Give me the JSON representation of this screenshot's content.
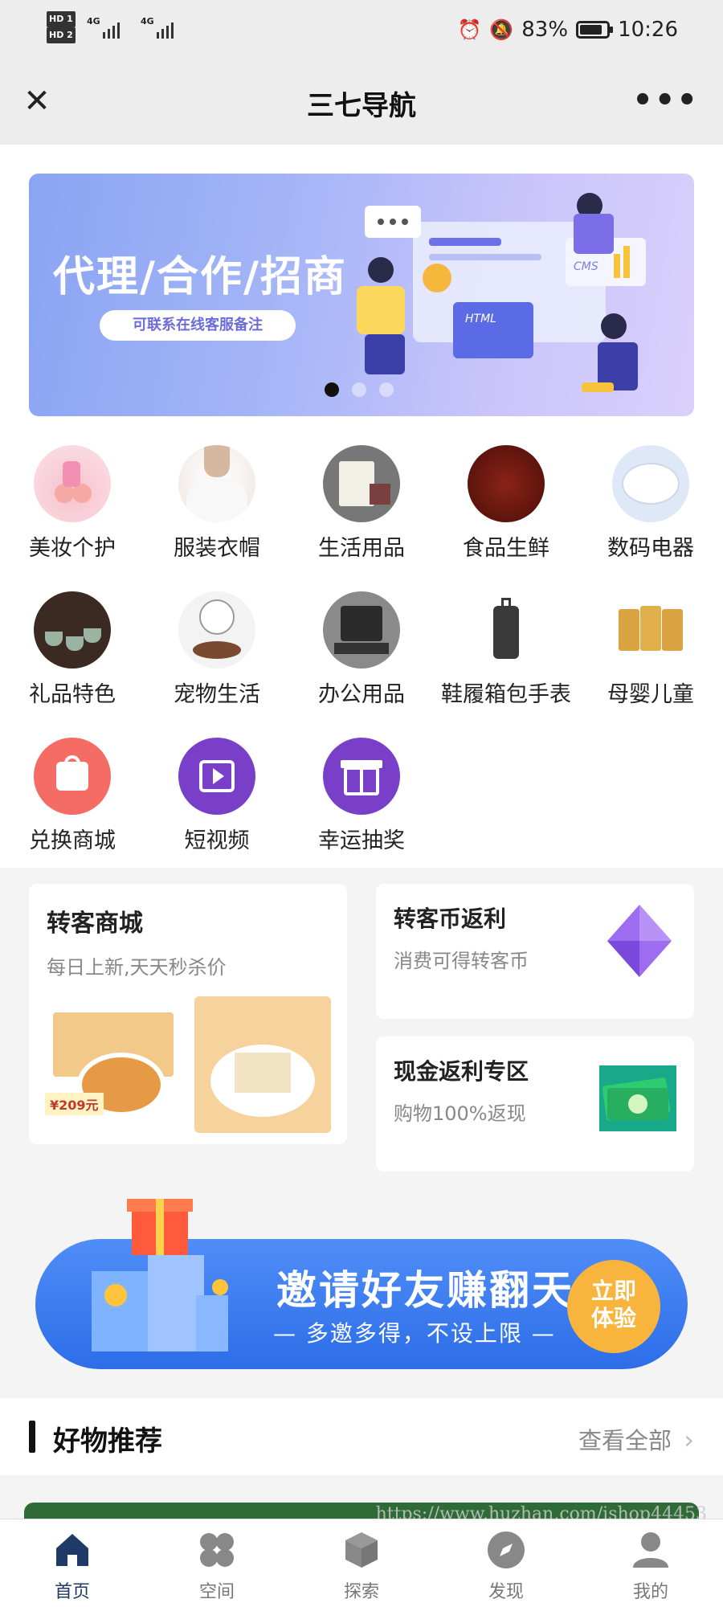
{
  "status_bar": {
    "hd1": "HD 1",
    "hd2": "HD 2",
    "net1": "4G",
    "net2": "4G",
    "battery": "83%",
    "battery_level": 0.83,
    "time": "10:26"
  },
  "titlebar": {
    "title": "三七导航"
  },
  "banner": {
    "title": "代理/合作/招商",
    "subtitle": "可联系在线客服备注",
    "art_labels": [
      "CMS",
      "HTML"
    ],
    "active_slide": 1,
    "slide_count": 3
  },
  "categories": [
    {
      "label": "美妆个护",
      "icon": "cosmetics-icon"
    },
    {
      "label": "服装衣帽",
      "icon": "clothing-icon"
    },
    {
      "label": "生活用品",
      "icon": "daily-goods-icon"
    },
    {
      "label": "食品生鲜",
      "icon": "food-icon"
    },
    {
      "label": "数码电器",
      "icon": "electronics-icon"
    },
    {
      "label": "礼品特色",
      "icon": "gift-tea-icon"
    },
    {
      "label": "宠物生活",
      "icon": "pet-icon"
    },
    {
      "label": "办公用品",
      "icon": "office-icon"
    },
    {
      "label": "鞋履箱包手表",
      "icon": "luggage-icon"
    },
    {
      "label": "母婴儿童",
      "icon": "baby-icon"
    },
    {
      "label": "兑换商城",
      "icon": "shopping-bag-icon"
    },
    {
      "label": "短视频",
      "icon": "video-icon"
    },
    {
      "label": "幸运抽奖",
      "icon": "lottery-gift-icon"
    }
  ],
  "promo": {
    "mall": {
      "title": "转客商城",
      "subtitle": "每日上新,天天秒杀价",
      "price_tag": "¥209元"
    },
    "coin": {
      "title": "转客币返利",
      "subtitle": "消费可得转客币"
    },
    "cash": {
      "title": "现金返利专区",
      "subtitle": "购物100%返现"
    }
  },
  "invite": {
    "title": "邀请好友赚翻天",
    "subtitle": "— 多邀多得，不设上限 —",
    "button": "立即体验"
  },
  "section": {
    "title": "好物推荐",
    "more": "查看全部"
  },
  "watermark": "https://www.huzhan.com/ishop44453",
  "nav": [
    {
      "label": "首页",
      "icon": "home-icon",
      "active": true
    },
    {
      "label": "空间",
      "icon": "space-icon",
      "active": false
    },
    {
      "label": "探索",
      "icon": "cube-icon",
      "active": false
    },
    {
      "label": "发现",
      "icon": "compass-icon",
      "active": false
    },
    {
      "label": "我的",
      "icon": "user-icon",
      "active": false
    }
  ],
  "colors": {
    "accent_blue": "#2d6de8",
    "banner_start": "#8aa4f3",
    "nav_active": "#1f3a66",
    "invite_button": "#f8b43c",
    "purple_icon": "#7a3fc8"
  }
}
